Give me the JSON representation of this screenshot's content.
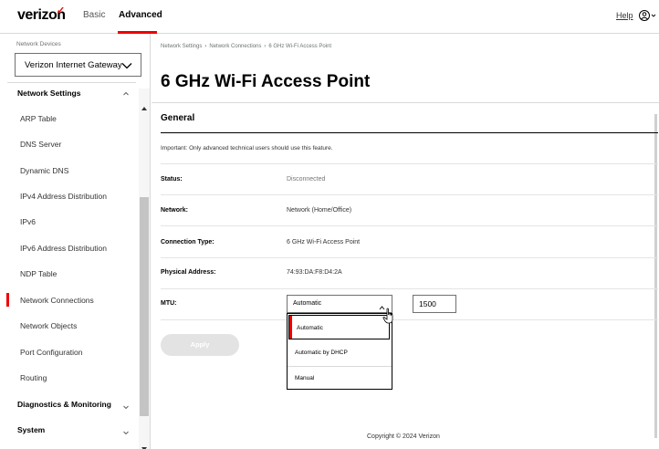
{
  "header": {
    "brand": "verizon",
    "nav": {
      "basic": "Basic",
      "advanced": "Advanced"
    },
    "help": "Help",
    "user_icon": "user-circle-icon"
  },
  "sidebar": {
    "devices_label": "Network Devices",
    "device_selected": "Verizon Internet Gateway",
    "section_network": "Network Settings",
    "items": [
      "ARP Table",
      "DNS Server",
      "Dynamic DNS",
      "IPv4 Address Distribution",
      "IPv6",
      "IPv6 Address Distribution",
      "NDP Table",
      "Network Connections",
      "Network Objects",
      "Port Configuration",
      "Routing"
    ],
    "active_item": "Network Connections",
    "section_diagnostics": "Diagnostics & Monitoring",
    "section_system": "System"
  },
  "breadcrumb": {
    "level1": "Network Settings",
    "level2": "Network Connections",
    "level3": "6 GHz Wi-Fi Access Point"
  },
  "main": {
    "title": "6 GHz Wi-Fi Access Point",
    "section_title": "General",
    "notice": "Important: Only advanced technical users should use this feature.",
    "fields": {
      "status_label": "Status:",
      "status_value": "Disconnected",
      "network_label": "Network:",
      "network_value": "Network (Home/Office)",
      "connection_type_label": "Connection Type:",
      "connection_type_value": "6 GHz Wi-Fi Access Point",
      "physical_address_label": "Physical Address:",
      "physical_address_value": "74:93:DA:F8:D4:2A",
      "mtu_label": "MTU:",
      "mtu_select_value": "Automatic",
      "mtu_value": "1500"
    },
    "mtu_options": [
      "Automatic",
      "Automatic by DHCP",
      "Manual"
    ],
    "apply_label": "Apply",
    "copyright": "Copyright © 2024 Verizon"
  },
  "colors": {
    "accent": "#ee0000",
    "border": "#d8dada",
    "muted": "#6f7171"
  }
}
